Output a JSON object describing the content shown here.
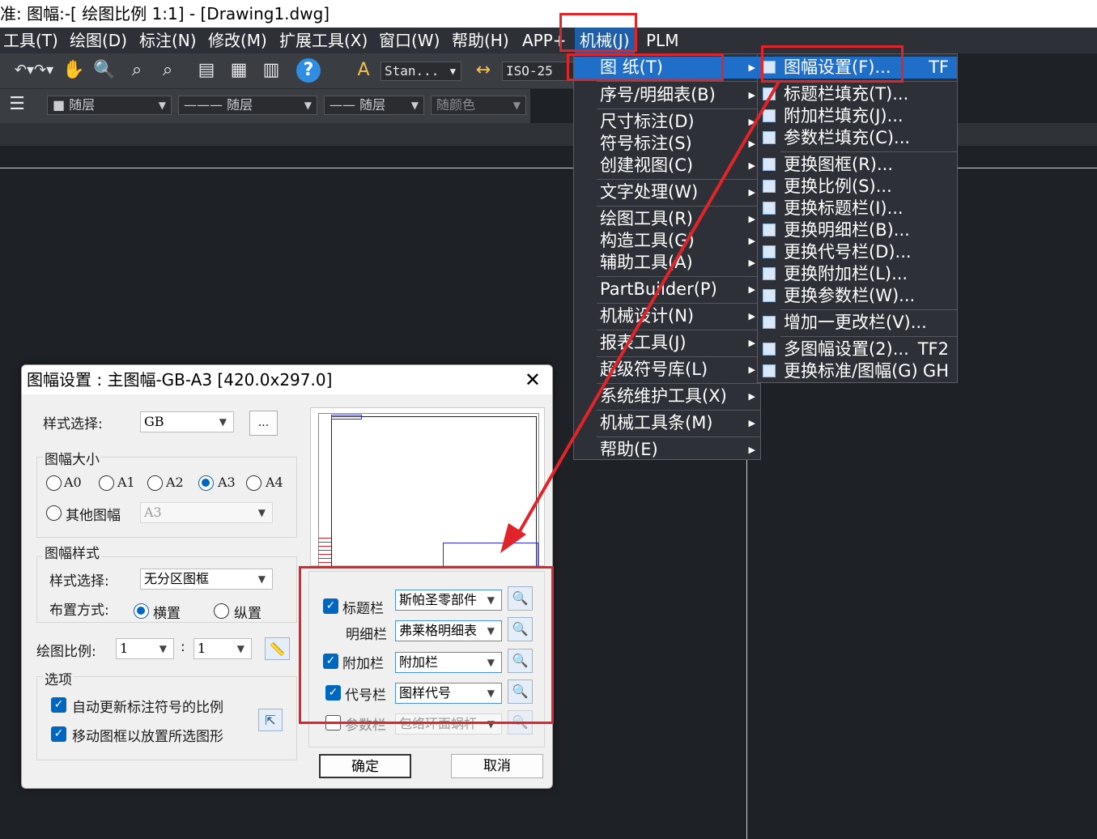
{
  "window": {
    "title": "准: 图幅:-[ 绘图比例 1:1] - [Drawing1.dwg]"
  },
  "menubar": {
    "items": [
      "工具(T)",
      "绘图(D)",
      "标注(N)",
      "修改(M)",
      "扩展工具(X)",
      "窗口(W)",
      "帮助(H)",
      "APP+",
      "机械(J)",
      "PLM"
    ]
  },
  "toolbar": {
    "text_style": "Stan...",
    "dim_style": "ISO-25",
    "layer": "随层",
    "linetype": "随层",
    "lineweight": "随层",
    "color": "随颜色"
  },
  "mech_menu": {
    "items": [
      {
        "label": "图    纸(T)",
        "submenu": true
      },
      {
        "label": "序号/明细表(B)",
        "submenu": true
      },
      {
        "label": "尺寸标注(D)",
        "submenu": true
      },
      {
        "label": "符号标注(S)",
        "submenu": true
      },
      {
        "label": "创建视图(C)",
        "submenu": true
      },
      {
        "label": "文字处理(W)",
        "submenu": true
      },
      {
        "label": "绘图工具(R)",
        "submenu": true
      },
      {
        "label": "构造工具(G)",
        "submenu": true
      },
      {
        "label": "辅助工具(A)",
        "submenu": true
      },
      {
        "label": "PartBuilder(P)",
        "submenu": true
      },
      {
        "label": "机械设计(N)",
        "submenu": true
      },
      {
        "label": "报表工具(J)",
        "submenu": true
      },
      {
        "label": "超级符号库(L)",
        "submenu": true
      },
      {
        "label": "系统维护工具(X)",
        "submenu": true
      },
      {
        "label": "机械工具条(M)",
        "submenu": true
      },
      {
        "label": "帮助(E)",
        "submenu": true
      }
    ]
  },
  "sheet_menu": {
    "items": [
      {
        "label": "图幅设置(F)...",
        "shortcut": "TF"
      },
      {
        "label": "标题栏填充(T)...",
        "shortcut": ""
      },
      {
        "label": "附加栏填充(J)...",
        "shortcut": ""
      },
      {
        "label": "参数栏填充(C)...",
        "shortcut": ""
      },
      {
        "label": "更换图框(R)...",
        "shortcut": ""
      },
      {
        "label": "更换比例(S)...",
        "shortcut": ""
      },
      {
        "label": "更换标题栏(I)...",
        "shortcut": ""
      },
      {
        "label": "更换明细栏(B)...",
        "shortcut": ""
      },
      {
        "label": "更换代号栏(D)...",
        "shortcut": ""
      },
      {
        "label": "更换附加栏(L)...",
        "shortcut": ""
      },
      {
        "label": "更换参数栏(W)...",
        "shortcut": ""
      },
      {
        "label": "增加一更改栏(V)...",
        "shortcut": ""
      },
      {
        "label": "多图幅设置(2)...",
        "shortcut": "TF2"
      },
      {
        "label": "更换标准/图幅(G)",
        "shortcut": "GH"
      }
    ]
  },
  "dialog": {
    "title": "图幅设置 : 主图幅-GB-A3 [420.0x297.0]",
    "style_label": "样式选择:",
    "style_value": "GB",
    "more_button": "...",
    "size_group": "图幅大小",
    "sizes": [
      "A0",
      "A1",
      "A2",
      "A3",
      "A4"
    ],
    "selected_size": "A3",
    "other_size_label": "其他图幅",
    "other_size_value": "A3",
    "frame_group": "图幅样式",
    "frame_style_label": "样式选择:",
    "frame_style_value": "无分区图框",
    "layout_label": "布置方式:",
    "layout_landscape": "横置",
    "layout_portrait": "纵置",
    "scale_label": "绘图比例:",
    "scale_a": "1",
    "scale_sep": ":",
    "scale_b": "1",
    "options_group": "选项",
    "opt_auto_scale": "自动更新标注符号的比例",
    "opt_move_frame": "移动图框以放置所选图形",
    "columns": [
      {
        "label": "标题栏",
        "value": "斯帕圣零部件",
        "checked": true,
        "has_check": true,
        "enabled": true
      },
      {
        "label": "明细栏",
        "value": "弗莱格明细表",
        "checked": false,
        "has_check": false,
        "enabled": true
      },
      {
        "label": "附加栏",
        "value": "附加栏",
        "checked": true,
        "has_check": true,
        "enabled": true
      },
      {
        "label": "代号栏",
        "value": "图样代号",
        "checked": true,
        "has_check": true,
        "enabled": true
      },
      {
        "label": "参数栏",
        "value": "包络环面蜗杆",
        "checked": false,
        "has_check": true,
        "enabled": false
      }
    ],
    "ok": "确定",
    "cancel": "取消"
  },
  "annotation_color": "#e0242a"
}
